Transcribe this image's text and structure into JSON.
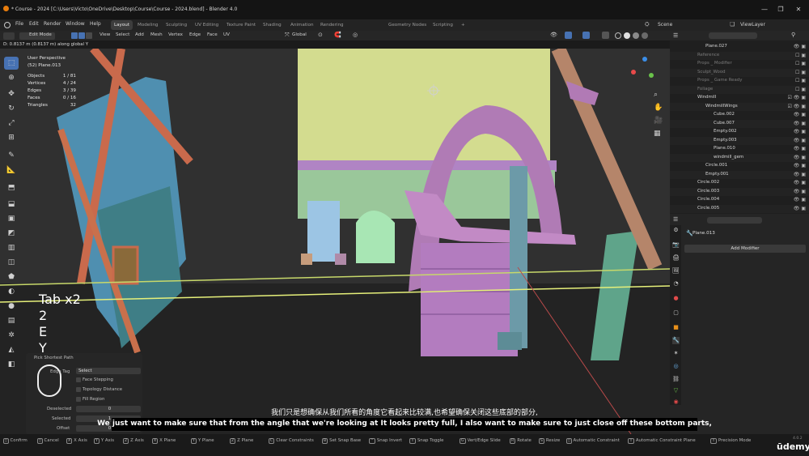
{
  "window": {
    "title": "* Course - 2024 [C:\\Users\\Victo\\OneDrive\\Desktop\\Course\\Course - 2024.blend] - Blender 4.0",
    "controls": [
      "—",
      "❐",
      "✕"
    ]
  },
  "menubar": {
    "items": [
      "File",
      "Edit",
      "Render",
      "Window",
      "Help"
    ],
    "workspaces": [
      "Layout",
      "Modeling",
      "Sculpting",
      "UV Editing",
      "Texture Paint",
      "Shading",
      "Animation",
      "Rendering",
      "Geometry Nodes",
      "Scripting",
      "+"
    ],
    "active_workspace": "Layout",
    "scene_label": "Scene",
    "view_layer_label": "ViewLayer"
  },
  "viewport_header": {
    "mode": "Edit Mode",
    "menus": [
      "View",
      "Select",
      "Add",
      "Mesh",
      "Vertex",
      "Edge",
      "Face",
      "UV"
    ],
    "orientation": "Global"
  },
  "status_line": "D: 0.8137 m (0.8137 m) along global Y",
  "viewport": {
    "view_name": "User Perspective",
    "active_object": "(52) Plane.013",
    "stats": [
      {
        "label": "Objects",
        "value": "1 / 81"
      },
      {
        "label": "Vertices",
        "value": "4 / 24"
      },
      {
        "label": "Edges",
        "value": "3 / 39"
      },
      {
        "label": "Faces",
        "value": "0 / 16"
      },
      {
        "label": "Triangles",
        "value": "32"
      }
    ],
    "key_overlay": [
      "Tab x2",
      "2",
      "E",
      "Y"
    ]
  },
  "operator_panel": {
    "title": "Pick Shortest Path",
    "edge_tag_label": "Edge Tag",
    "edge_tag_value": "Select",
    "options": [
      "Face Stepping",
      "Topology Distance",
      "Fill Region"
    ],
    "fields": [
      {
        "label": "Deselected",
        "value": "0"
      },
      {
        "label": "Selected",
        "value": "1"
      },
      {
        "label": "Offset",
        "value": "0"
      }
    ]
  },
  "outliner": {
    "rows": [
      "Plane.027",
      "Reference",
      "Props _ Modifier",
      "Sculpt_Wood",
      "Props _ Game Ready",
      "Foliage",
      "Windmill",
      "WindmillWings",
      "Cube.002",
      "Cube.007",
      "Empty.002",
      "Empty.003",
      "Plane.010",
      "windmill_gem",
      "Circle.001",
      "Empty.001",
      "Circle.002",
      "Circle.003",
      "Circle.004",
      "Circle.005"
    ]
  },
  "properties": {
    "object_name": "Plane.013",
    "add_modifier_label": "Add Modifier"
  },
  "subtitles": {
    "cn": "我们只是想确保从我们所看的角度它看起来比较满,也希望确保关闭这些底部的部分,",
    "en": "We just want to make sure that from the angle that we're looking at It looks pretty full, I also want to make sure to just close off these bottom parts,"
  },
  "statusbar": {
    "items": [
      {
        "key": "",
        "label": "Confirm"
      },
      {
        "key": "",
        "label": "Cancel"
      },
      {
        "key": "X",
        "label": "X Axis"
      },
      {
        "key": "Y",
        "label": "Y Axis"
      },
      {
        "key": "Z",
        "label": "Z Axis"
      },
      {
        "key": "X",
        "label": "X Plane"
      },
      {
        "key": "Y",
        "label": "Y Plane"
      },
      {
        "key": "Z",
        "label": "Z Plane"
      },
      {
        "key": "C",
        "label": "Clear Constraints"
      },
      {
        "key": "B",
        "label": "Set Snap Base"
      },
      {
        "key": "",
        "label": "Snap Invert"
      },
      {
        "key": "",
        "label": "Snap Toggle"
      },
      {
        "key": "G",
        "label": "Vert/Edge Slide"
      },
      {
        "key": "R",
        "label": "Rotate"
      },
      {
        "key": "S",
        "label": "Resize"
      },
      {
        "key": "",
        "label": "Automatic Constraint"
      },
      {
        "key": "",
        "label": "Automatic Constraint Plane"
      },
      {
        "key": "",
        "label": "Precision Mode"
      }
    ],
    "version": "4.0.2",
    "watermark": "ūdemy"
  }
}
